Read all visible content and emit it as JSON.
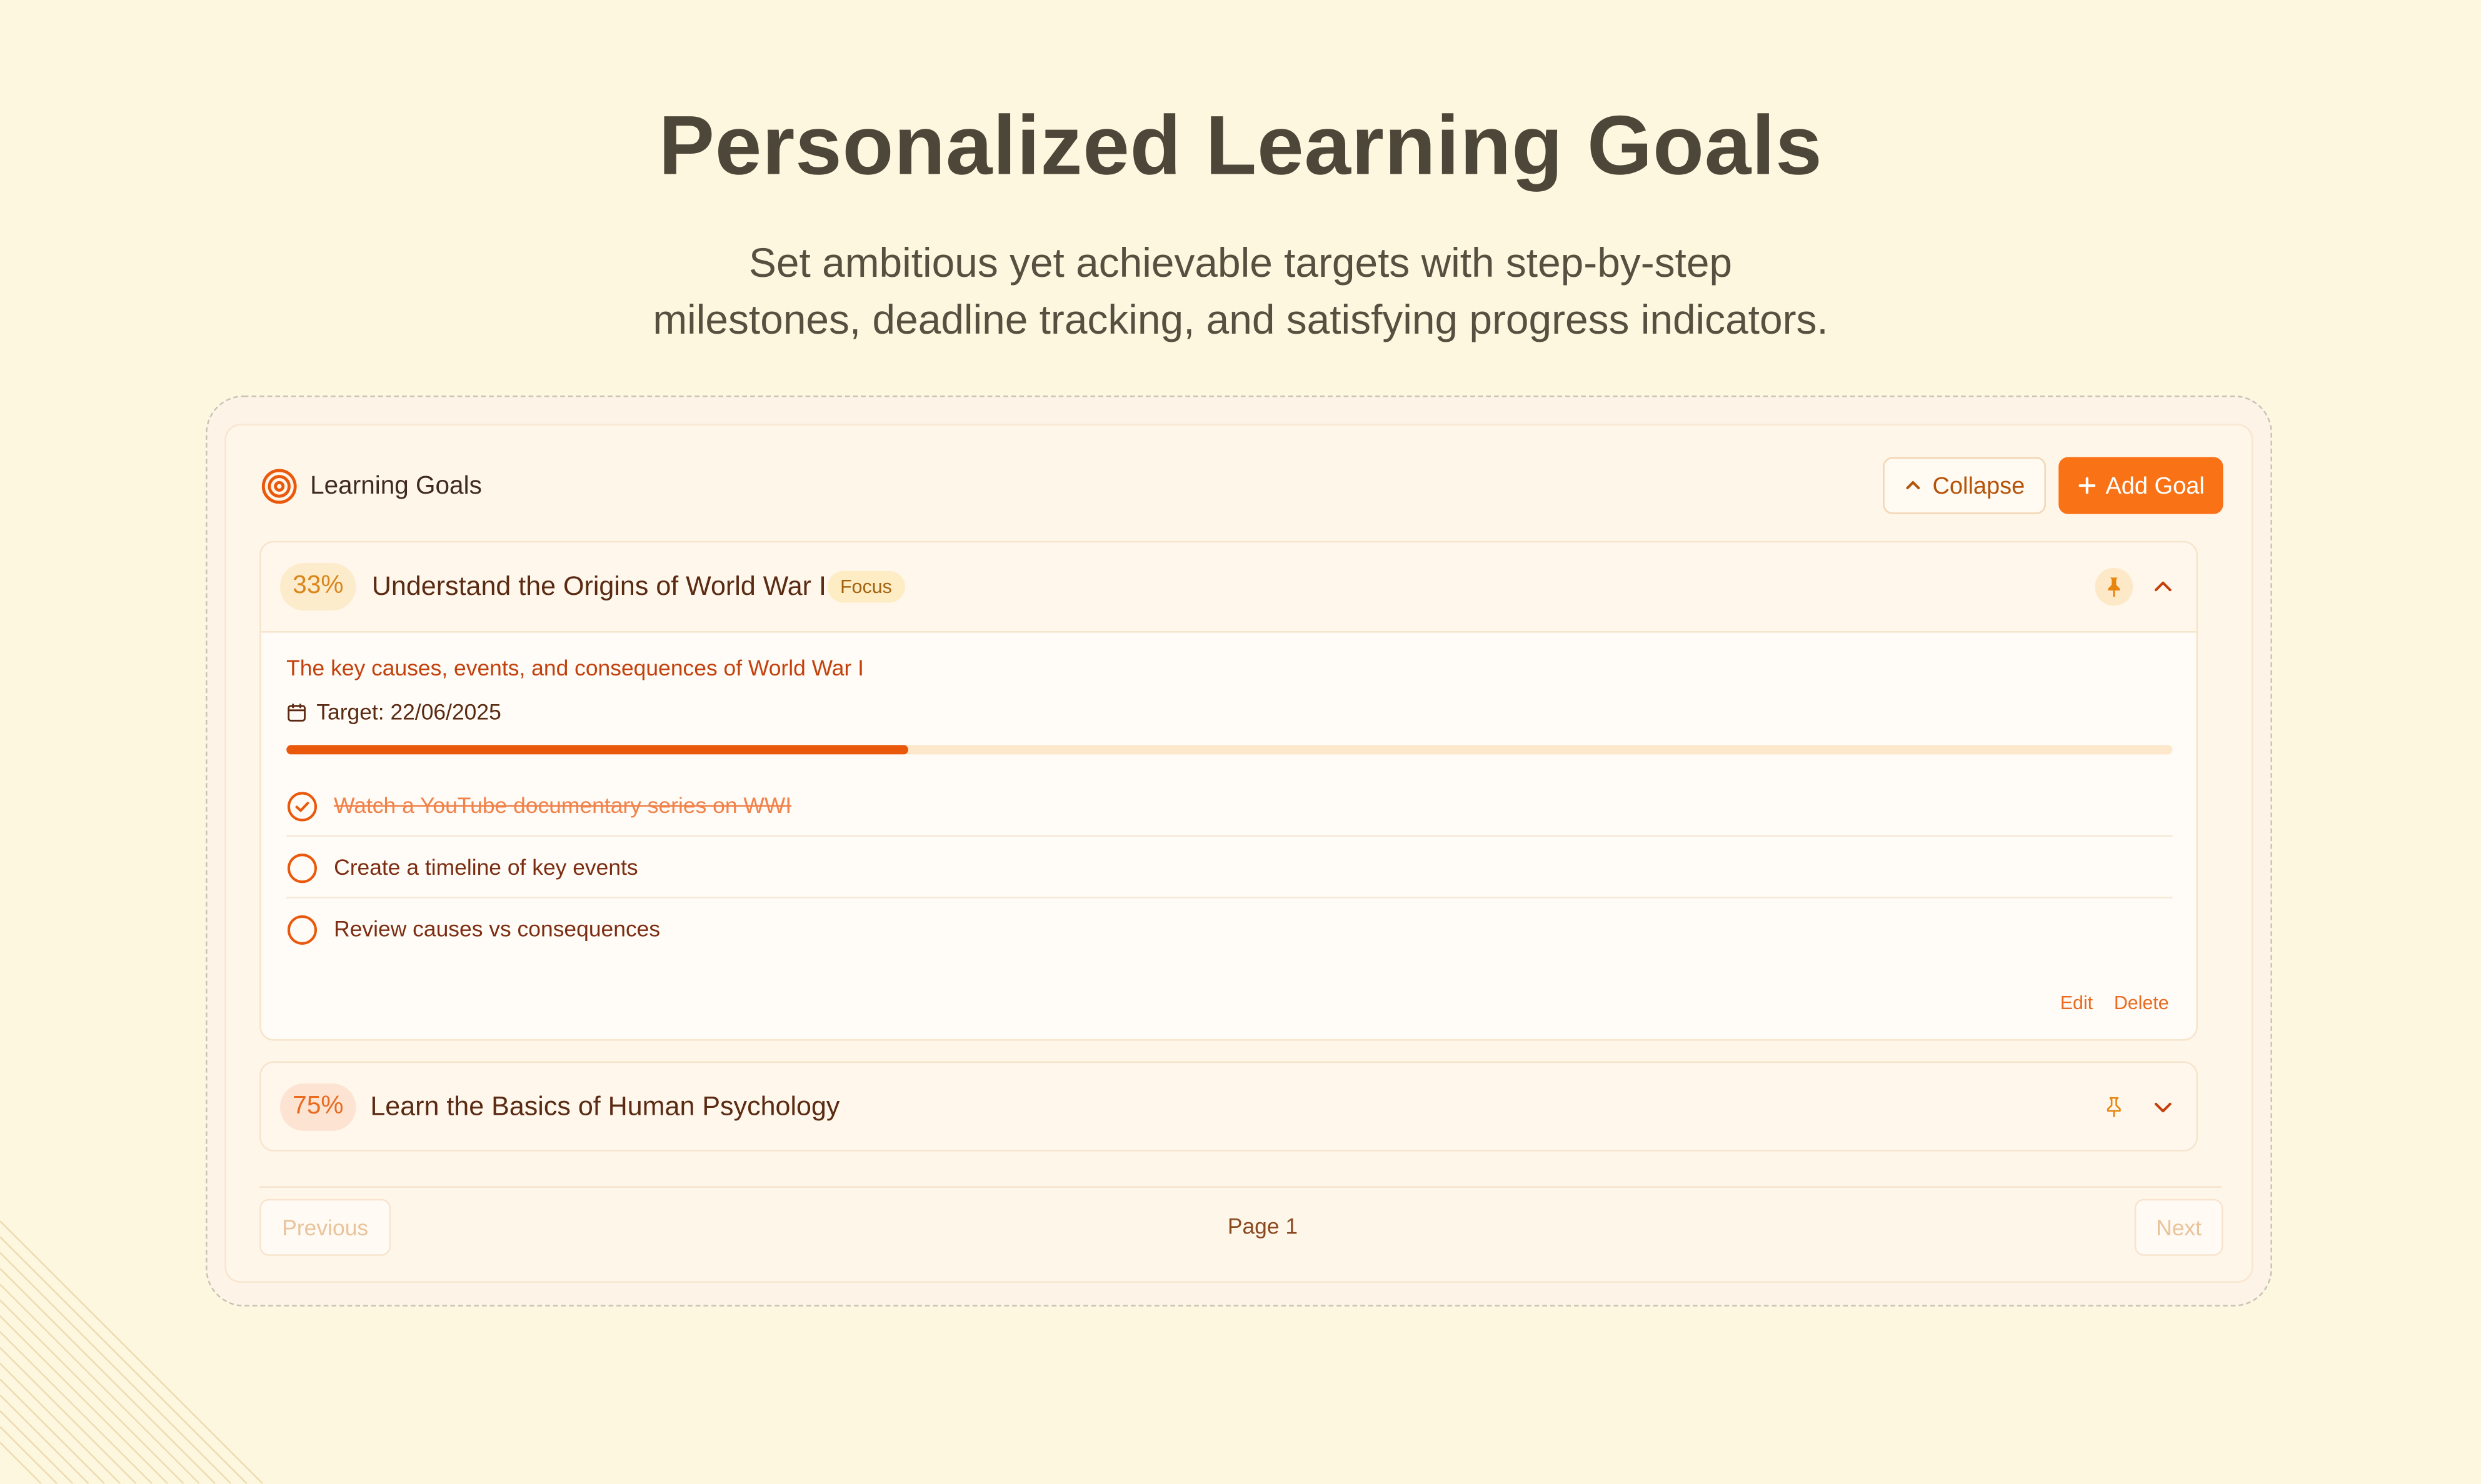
{
  "hero": {
    "title": "Personalized Learning Goals",
    "subtitle_line1": "Set ambitious yet achievable targets with step-by-step",
    "subtitle_line2": "milestones, deadline tracking, and satisfying progress indicators."
  },
  "panel": {
    "title": "Learning Goals",
    "icon": "target-icon",
    "collapse_label": "Collapse",
    "add_label": "Add Goal"
  },
  "goals": [
    {
      "percent_label": "33%",
      "progress": 0.33,
      "title": "Understand the Origins of World War I",
      "tag": "Focus",
      "pinned": true,
      "expanded": true,
      "description": "The key causes, events, and consequences of World War I",
      "target": "Target: 22/06/2025",
      "milestones": [
        {
          "label": "Watch a YouTube documentary series on WWI",
          "done": true
        },
        {
          "label": "Create a timeline of key events",
          "done": false
        },
        {
          "label": "Review causes vs consequences",
          "done": false
        }
      ],
      "edit_label": "Edit",
      "delete_label": "Delete"
    },
    {
      "percent_label": "75%",
      "progress": 0.75,
      "title": "Learn the Basics of Human Psychology",
      "pinned": false,
      "expanded": false
    }
  ],
  "pagination": {
    "previous": "Previous",
    "page": "Page 1",
    "next": "Next"
  },
  "colors": {
    "background": "#fef7e0",
    "accent": "#f97316",
    "progress_fill": "#ea580c",
    "heading": "#4c4738"
  }
}
